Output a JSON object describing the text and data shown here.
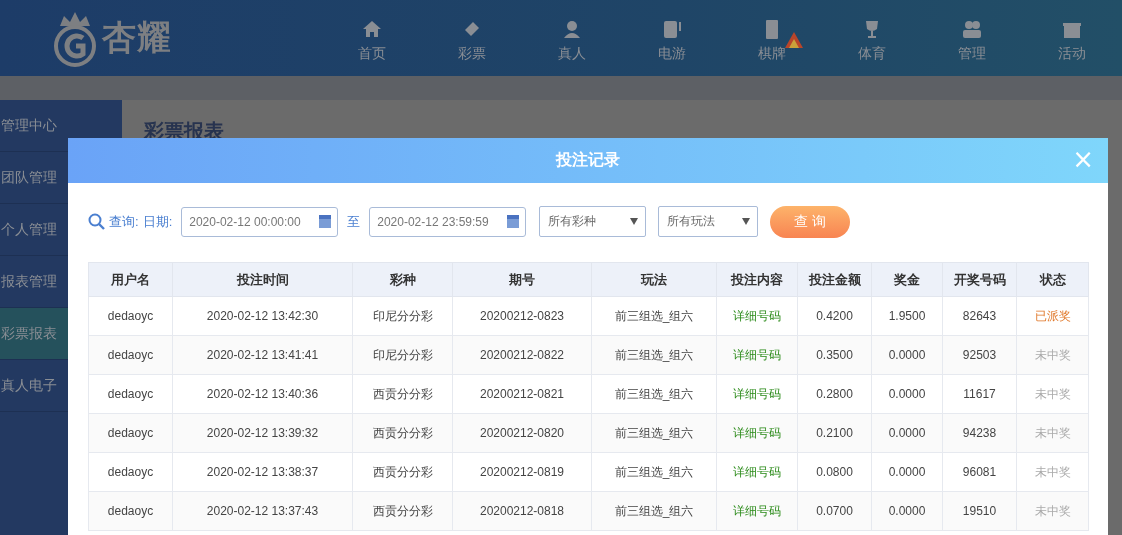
{
  "logo": {
    "text": "杏耀"
  },
  "nav": [
    {
      "label": "首页",
      "kind": "home",
      "badge": false
    },
    {
      "label": "彩票",
      "kind": "ticket",
      "badge": false
    },
    {
      "label": "真人",
      "kind": "person",
      "badge": false
    },
    {
      "label": "电游",
      "kind": "slot",
      "badge": false
    },
    {
      "label": "棋牌",
      "kind": "tile",
      "badge": true
    },
    {
      "label": "体育",
      "kind": "trophy",
      "badge": false
    },
    {
      "label": "管理",
      "kind": "people",
      "badge": false
    },
    {
      "label": "活动",
      "kind": "gift",
      "badge": false
    }
  ],
  "sidebar": {
    "items": [
      {
        "label": "管理中心",
        "selected": false
      },
      {
        "label": "团队管理",
        "selected": false
      },
      {
        "label": "个人管理",
        "selected": false
      },
      {
        "label": "报表管理",
        "selected": false
      },
      {
        "label": "彩票报表",
        "selected": true
      },
      {
        "label": "真人电子",
        "selected": false
      }
    ]
  },
  "page_title": "彩票报表",
  "modal": {
    "title": "投注记录",
    "close": "×",
    "filters": {
      "query_label": "查询:",
      "date_label": "日期:",
      "start": "2020-02-12 00:00:00",
      "to": "至",
      "end": "2020-02-12 23:59:59",
      "lottery": "所有彩种",
      "play": "所有玩法",
      "button": "查 询"
    },
    "table": {
      "columns": [
        "用户名",
        "投注时间",
        "彩种",
        "期号",
        "玩法",
        "投注内容",
        "投注金额",
        "奖金",
        "开奖号码",
        "状态"
      ],
      "rows": [
        {
          "user": "dedaoyc",
          "time": "2020-02-12 13:42:30",
          "lottery": "印尼分分彩",
          "issue": "20200212-0823",
          "play": "前三组选_组六",
          "content": "详细号码",
          "amount": "0.4200",
          "prize": "1.9500",
          "numbers": "82643",
          "status": "已派奖",
          "won": true
        },
        {
          "user": "dedaoyc",
          "time": "2020-02-12 13:41:41",
          "lottery": "印尼分分彩",
          "issue": "20200212-0822",
          "play": "前三组选_组六",
          "content": "详细号码",
          "amount": "0.3500",
          "prize": "0.0000",
          "numbers": "92503",
          "status": "未中奖",
          "won": false
        },
        {
          "user": "dedaoyc",
          "time": "2020-02-12 13:40:36",
          "lottery": "西贡分分彩",
          "issue": "20200212-0821",
          "play": "前三组选_组六",
          "content": "详细号码",
          "amount": "0.2800",
          "prize": "0.0000",
          "numbers": "11617",
          "status": "未中奖",
          "won": false
        },
        {
          "user": "dedaoyc",
          "time": "2020-02-12 13:39:32",
          "lottery": "西贡分分彩",
          "issue": "20200212-0820",
          "play": "前三组选_组六",
          "content": "详细号码",
          "amount": "0.2100",
          "prize": "0.0000",
          "numbers": "94238",
          "status": "未中奖",
          "won": false
        },
        {
          "user": "dedaoyc",
          "time": "2020-02-12 13:38:37",
          "lottery": "西贡分分彩",
          "issue": "20200212-0819",
          "play": "前三组选_组六",
          "content": "详细号码",
          "amount": "0.0800",
          "prize": "0.0000",
          "numbers": "96081",
          "status": "未中奖",
          "won": false
        },
        {
          "user": "dedaoyc",
          "time": "2020-02-12 13:37:43",
          "lottery": "西贡分分彩",
          "issue": "20200212-0818",
          "play": "前三组选_组六",
          "content": "详细号码",
          "amount": "0.0700",
          "prize": "0.0000",
          "numbers": "19510",
          "status": "未中奖",
          "won": false
        }
      ]
    }
  }
}
